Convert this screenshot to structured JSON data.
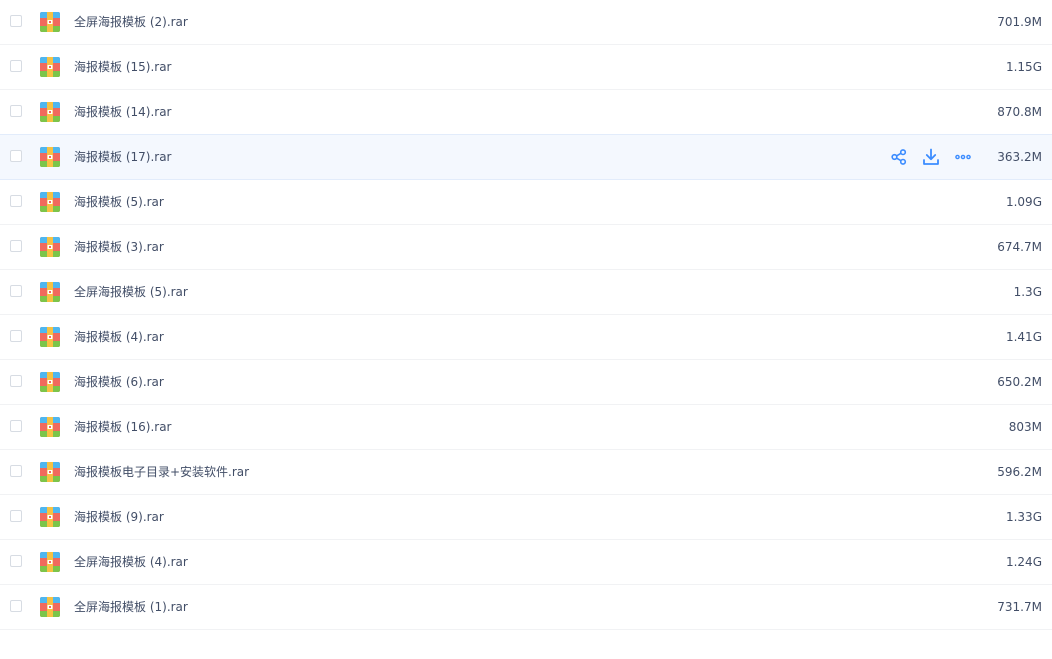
{
  "colors": {
    "text": "#424e67",
    "accent": "#3b8cff",
    "row_hover_bg": "#f4f8fe",
    "divider": "#f1f2f4"
  },
  "row_icon": "archive-rar-icon",
  "hover_actions": [
    {
      "name": "share",
      "icon": "share-icon"
    },
    {
      "name": "download",
      "icon": "download-icon"
    },
    {
      "name": "more",
      "icon": "more-icon"
    }
  ],
  "files": [
    {
      "name": "全屏海报模板 (2).rar",
      "size": "701.9M",
      "hovered": false
    },
    {
      "name": "海报模板 (15).rar",
      "size": "1.15G",
      "hovered": false
    },
    {
      "name": "海报模板 (14).rar",
      "size": "870.8M",
      "hovered": false
    },
    {
      "name": "海报模板 (17).rar",
      "size": "363.2M",
      "hovered": true
    },
    {
      "name": "海报模板 (5).rar",
      "size": "1.09G",
      "hovered": false
    },
    {
      "name": "海报模板 (3).rar",
      "size": "674.7M",
      "hovered": false
    },
    {
      "name": "全屏海报模板 (5).rar",
      "size": "1.3G",
      "hovered": false
    },
    {
      "name": "海报模板 (4).rar",
      "size": "1.41G",
      "hovered": false
    },
    {
      "name": "海报模板 (6).rar",
      "size": "650.2M",
      "hovered": false
    },
    {
      "name": "海报模板 (16).rar",
      "size": "803M",
      "hovered": false
    },
    {
      "name": "海报模板电子目录+安装软件.rar",
      "size": "596.2M",
      "hovered": false
    },
    {
      "name": "海报模板 (9).rar",
      "size": "1.33G",
      "hovered": false
    },
    {
      "name": "全屏海报模板 (4).rar",
      "size": "1.24G",
      "hovered": false
    },
    {
      "name": "全屏海报模板 (1).rar",
      "size": "731.7M",
      "hovered": false
    }
  ]
}
